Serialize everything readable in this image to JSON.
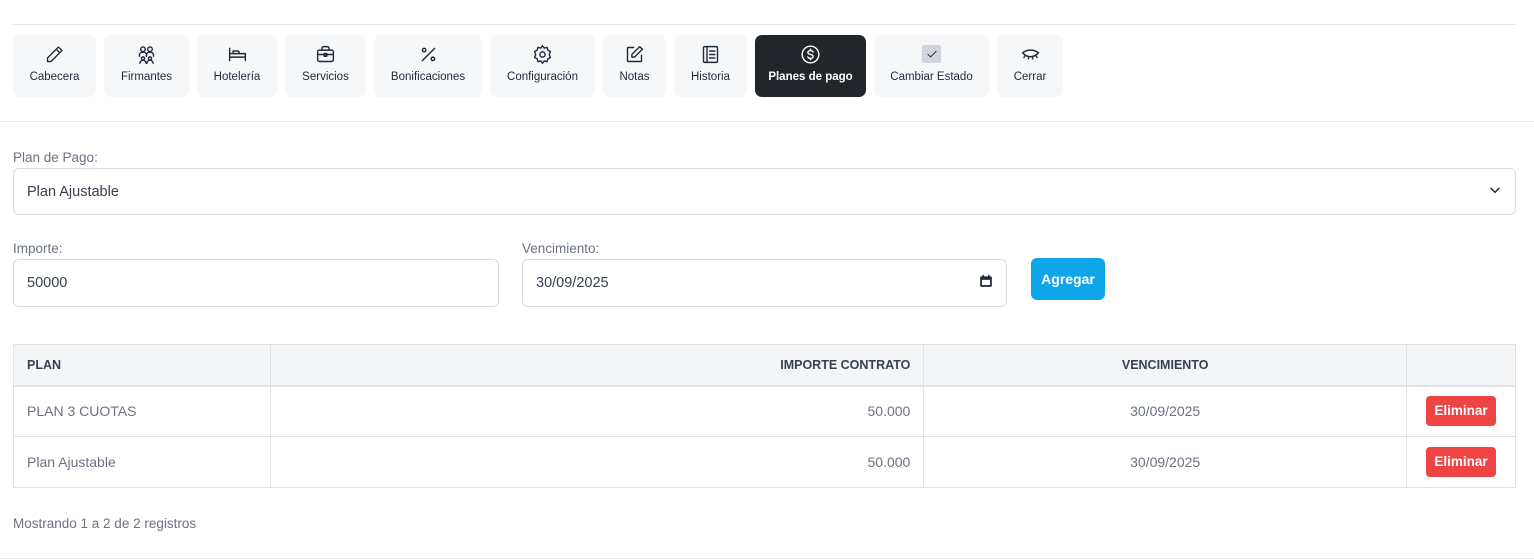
{
  "toolbar": {
    "items": [
      {
        "label": "Cabecera",
        "icon": "pencil-icon"
      },
      {
        "label": "Firmantes",
        "icon": "people-icon"
      },
      {
        "label": "Hotelería",
        "icon": "bed-icon"
      },
      {
        "label": "Servicios",
        "icon": "briefcase-icon"
      },
      {
        "label": "Bonificaciones",
        "icon": "percent-icon"
      },
      {
        "label": "Configuración",
        "icon": "gear-icon"
      },
      {
        "label": "Notas",
        "icon": "edit-note-icon"
      },
      {
        "label": "Historia",
        "icon": "notebook-icon"
      },
      {
        "label": "Planes de pago",
        "icon": "dollar-circle-icon",
        "active": true
      },
      {
        "label": "Cambiar Estado",
        "icon": "checkbox-icon"
      },
      {
        "label": "Cerrar",
        "icon": "closed-eye-icon"
      }
    ],
    "active_bg": "#22252a"
  },
  "form": {
    "plan_label": "Plan de Pago:",
    "plan_value": "Plan Ajustable",
    "importe_label": "Importe:",
    "importe_value": "50000",
    "vencimiento_label": "Vencimiento:",
    "vencimiento_value": "30/09/2025",
    "add_button": "Agregar",
    "add_color": "#0ea5e9"
  },
  "table": {
    "headers": [
      "PLAN",
      "IMPORTE CONTRATO",
      "VENCIMIENTO",
      ""
    ],
    "rows": [
      {
        "plan": "PLAN 3 CUOTAS",
        "importe": "50.000",
        "vencimiento": "30/09/2025",
        "action": "Eliminar"
      },
      {
        "plan": "Plan Ajustable",
        "importe": "50.000",
        "vencimiento": "30/09/2025",
        "action": "Eliminar"
      }
    ],
    "delete_color": "#ef4444"
  },
  "footer": {
    "info": "Mostrando 1 a 2 de 2 registros"
  }
}
